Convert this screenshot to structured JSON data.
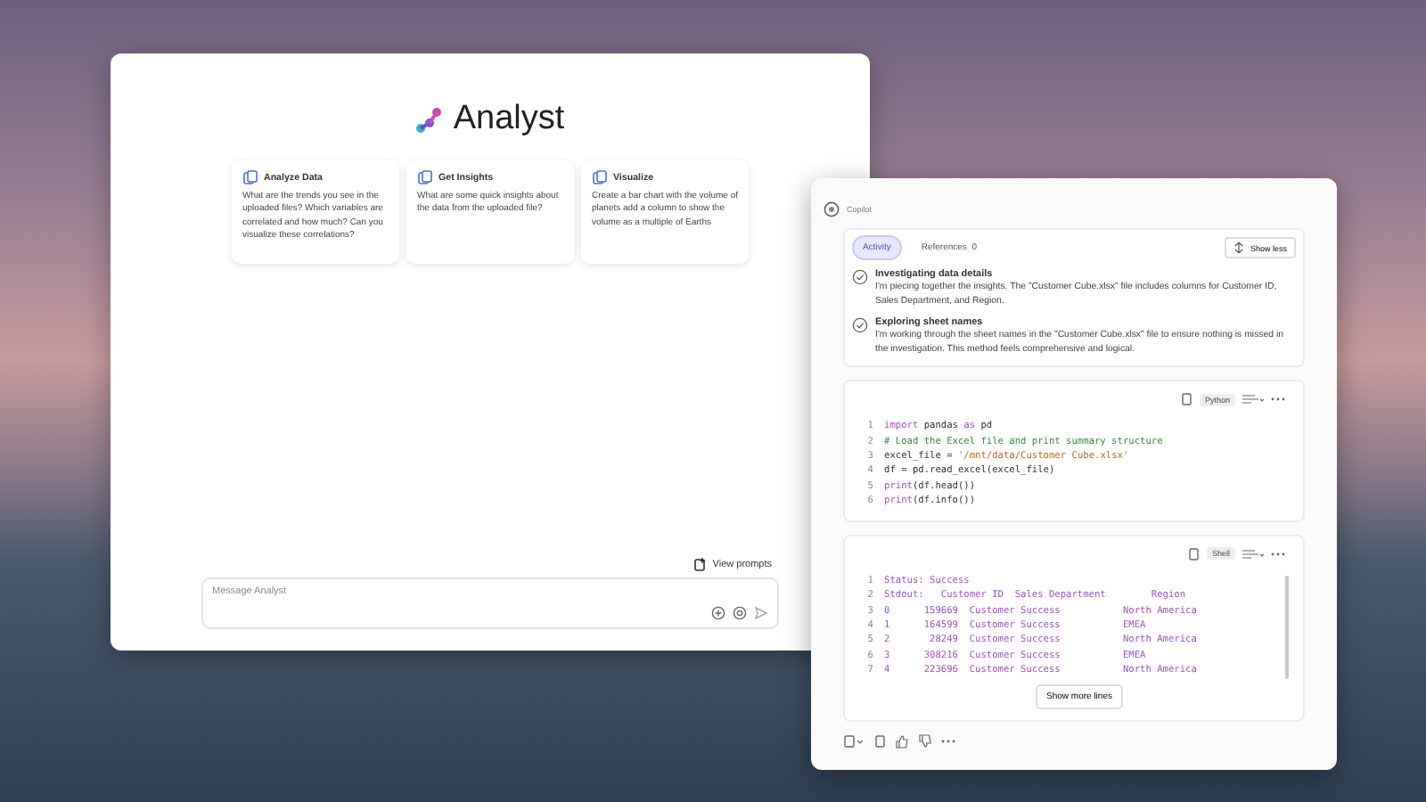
{
  "analyst": {
    "title": "Analyst",
    "cards": [
      {
        "title": "Analyze Data",
        "text": "What are the trends you see in the uploaded files? Which variables are correlated and how much? Can you visualize these correlations?"
      },
      {
        "title": "Get Insights",
        "text": "What are some quick insights about the data from the uploaded file?"
      },
      {
        "title": "Visualize",
        "text": "Create a bar chart with the volume of planets add a column to show the volume as a multiple of Earths"
      }
    ],
    "view_prompts": "View prompts",
    "message": {
      "placeholder": "Message Analyst"
    }
  },
  "copilot": {
    "title": "Copilot",
    "tabs": [
      {
        "label": "Activity",
        "selected": true
      },
      {
        "label": "References",
        "count": "0",
        "selected": false
      }
    ],
    "show_less": "Show less",
    "activity": [
      {
        "title": "Investigating data details",
        "text": "I'm piecing together the insights. The \"Customer Cube.xlsx\" file includes columns for Customer ID, Sales Department, and Region."
      },
      {
        "title": "Exploring sheet names",
        "text": "I'm working through the sheet names in the \"Customer Cube.xlsx\" file to ensure nothing is missed in the investigation. This method feels comprehensive and logical."
      }
    ],
    "code_blocks": [
      {
        "language": "Python",
        "lines": [
          {
            "number": "1",
            "segments": [
              {
                "kind": "keyword",
                "text": "import"
              },
              {
                "kind": "plain",
                "text": " pandas "
              },
              {
                "kind": "keyword",
                "text": "as"
              },
              {
                "kind": "plain",
                "text": " pd"
              }
            ]
          },
          {
            "number": "2",
            "segments": [
              {
                "kind": "comment",
                "text": "# Load the Excel file and print summary structure"
              }
            ]
          },
          {
            "number": "3",
            "segments": [
              {
                "kind": "plain",
                "text": "excel_file = "
              },
              {
                "kind": "string",
                "text": "'/mnt/data/Customer Cube.xlsx'"
              }
            ]
          },
          {
            "number": "4",
            "segments": [
              {
                "kind": "plain",
                "text": "df = pd.read_excel(excel_file)"
              }
            ]
          },
          {
            "number": "5",
            "segments": [
              {
                "kind": "keyword",
                "text": "print"
              },
              {
                "kind": "plain",
                "text": "(df.head())"
              }
            ]
          },
          {
            "number": "6",
            "segments": [
              {
                "kind": "keyword",
                "text": "print"
              },
              {
                "kind": "plain",
                "text": "(df.info())"
              }
            ]
          }
        ]
      },
      {
        "language": "Shell",
        "show_more": "Show more lines",
        "lines": [
          {
            "number": "1",
            "segments": [
              {
                "kind": "output",
                "text": "Status: Success"
              }
            ]
          },
          {
            "number": "2",
            "segments": [
              {
                "kind": "output",
                "text": "Stdout:   Customer ID  Sales Department        Region"
              }
            ]
          },
          {
            "number": "3",
            "segments": [
              {
                "kind": "output",
                "text": "0      159669  Customer Success           North America"
              }
            ]
          },
          {
            "number": "4",
            "segments": [
              {
                "kind": "output",
                "text": "1      164599  Customer Success           EMEA"
              }
            ]
          },
          {
            "number": "5",
            "segments": [
              {
                "kind": "output",
                "text": "2       28249  Customer Success           North America"
              }
            ]
          },
          {
            "number": "6",
            "segments": [
              {
                "kind": "output",
                "text": "3      308216  Customer Success           EMEA"
              }
            ]
          },
          {
            "number": "7",
            "segments": [
              {
                "kind": "output",
                "text": "4      223696  Customer Success           North America"
              }
            ]
          }
        ]
      }
    ]
  }
}
